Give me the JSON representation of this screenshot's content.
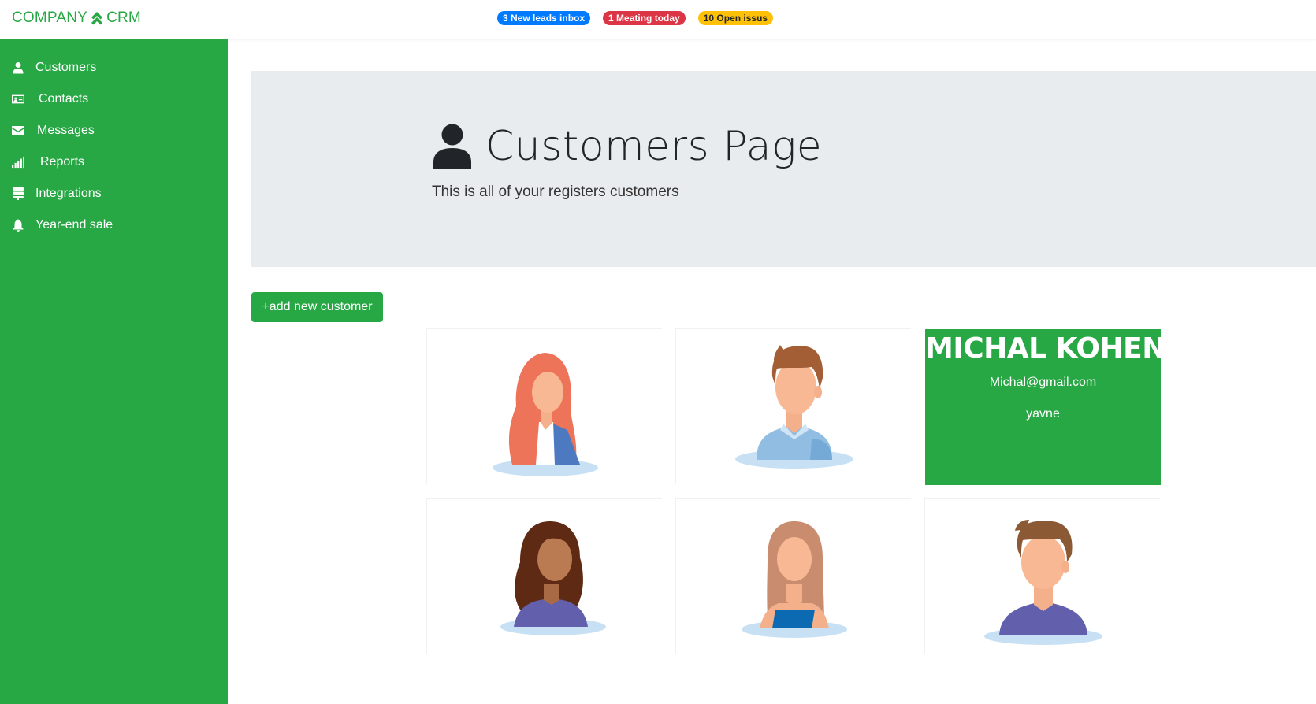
{
  "brand": {
    "left": "COMPANY",
    "right": "CRM",
    "icon": "double-chevron-up-icon"
  },
  "badges": [
    {
      "label": "3 New leads inbox",
      "color": "#007bff"
    },
    {
      "label": "1 Meating today",
      "color": "#dc3545"
    },
    {
      "label": "10 Open issus",
      "color": "#ffc107"
    }
  ],
  "sidebar": {
    "items": [
      {
        "label": "Customers",
        "icon": "user-icon"
      },
      {
        "label": "Contacts",
        "icon": "id-card-icon"
      },
      {
        "label": "Messages",
        "icon": "envelope-icon"
      },
      {
        "label": "Reports",
        "icon": "signal-bars-icon"
      },
      {
        "label": "Integrations",
        "icon": "server-icon"
      },
      {
        "label": "Year-end sale",
        "icon": "bell-icon"
      }
    ]
  },
  "jumbotron": {
    "title": "Customers Page",
    "subtitle": "This is all of your registers customers",
    "icon": "user-icon"
  },
  "actions": {
    "add_customer": "+add new customer"
  },
  "customers": [
    {
      "avatar": "woman-red-hair-avatar"
    },
    {
      "avatar": "man-brown-hair-avatar"
    },
    {
      "name": "MICHAL KOHEN",
      "email": "Michal@gmail.com",
      "city": "yavne",
      "hovered": true
    },
    {
      "avatar": "woman-curly-dark-hair-avatar"
    },
    {
      "avatar": "woman-long-light-hair-avatar"
    },
    {
      "avatar": "man-short-hair-avatar"
    }
  ],
  "colors": {
    "primary": "#28a745",
    "jumbotron": "#e9ecef"
  }
}
